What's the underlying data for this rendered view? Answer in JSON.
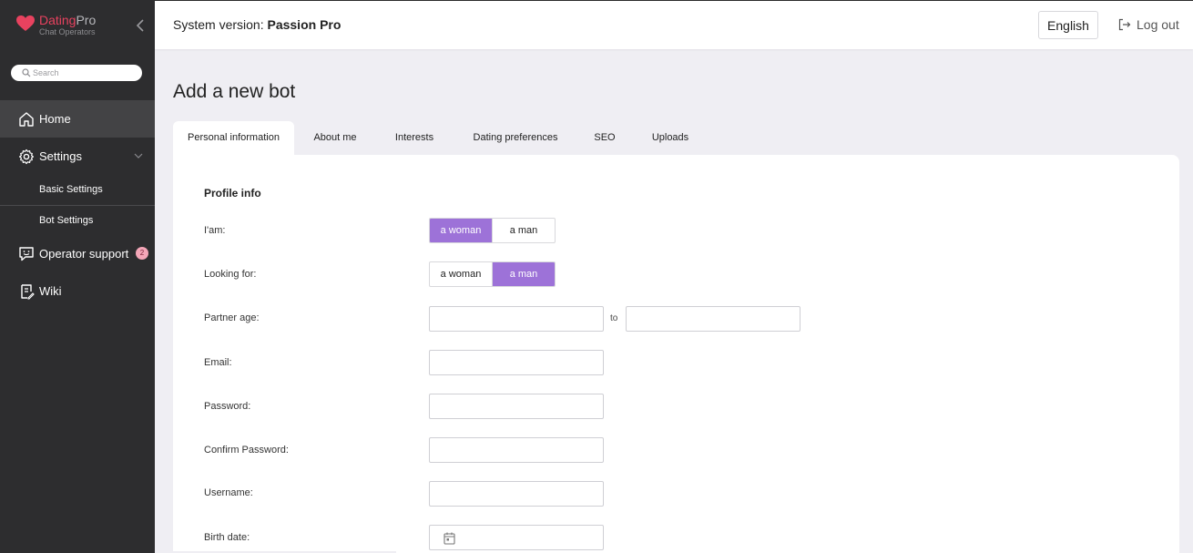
{
  "app": {
    "brand_part1": "Dating",
    "brand_part2": "Pro",
    "brand_sub": "Chat Operators",
    "accent_color": "#e8425f"
  },
  "sidebar": {
    "search_placeholder": "Search",
    "items": [
      {
        "label": "Home",
        "icon": "home-icon"
      },
      {
        "label": "Settings",
        "icon": "gear-icon"
      },
      {
        "label": "Basic Settings"
      },
      {
        "label": "Bot Settings"
      },
      {
        "label": "Operator support",
        "icon": "chat-support-icon",
        "badge": "2"
      },
      {
        "label": "Wiki",
        "icon": "wiki-icon"
      }
    ]
  },
  "header": {
    "system_version_label": "System version:",
    "system_version_value": "Passion Pro",
    "language": "English",
    "logout": "Log out"
  },
  "main": {
    "title": "Add a new bot",
    "tabs": [
      {
        "label": "Personal information",
        "active": true
      },
      {
        "label": "About me"
      },
      {
        "label": "Interests"
      },
      {
        "label": "Dating preferences"
      },
      {
        "label": "SEO"
      },
      {
        "label": "Uploads"
      }
    ],
    "section_title": "Profile info",
    "form": {
      "iam_label": "I'am:",
      "iam_options": [
        "a woman",
        "a man"
      ],
      "iam_selected": "a woman",
      "looking_label": "Looking for:",
      "looking_options": [
        "a woman",
        "a man"
      ],
      "looking_selected": "a man",
      "partner_age_label": "Partner age:",
      "to_label": "to",
      "email_label": "Email:",
      "password_label": "Password:",
      "confirm_password_label": "Confirm Password:",
      "username_label": "Username:",
      "birth_date_label": "Birth date:"
    },
    "selected_color": "#9d72d8"
  }
}
